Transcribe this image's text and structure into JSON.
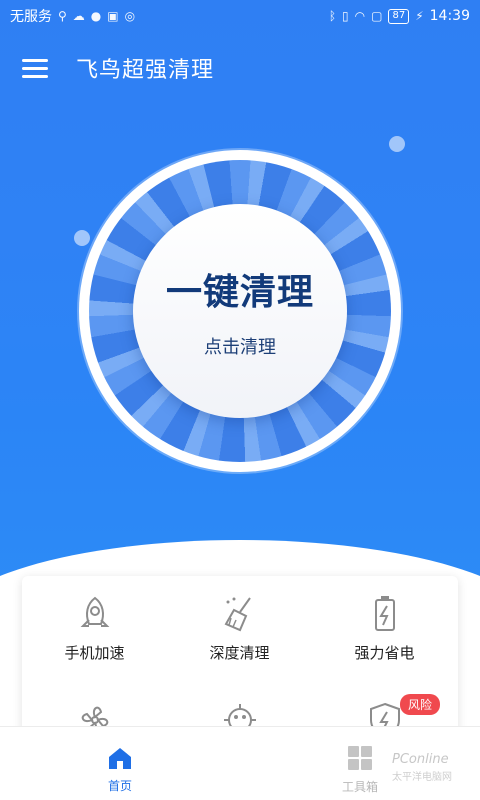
{
  "status_bar": {
    "carrier": "无服务",
    "battery": "87",
    "time": "14:39"
  },
  "header": {
    "title": "飞鸟超强清理",
    "menu_icon": "hamburger-menu-icon"
  },
  "cleaner": {
    "title": "一键清理",
    "subtitle": "点击清理"
  },
  "tools": [
    {
      "label": "手机加速",
      "icon": "rocket-icon"
    },
    {
      "label": "深度清理",
      "icon": "broom-icon"
    },
    {
      "label": "强力省电",
      "icon": "battery-icon"
    },
    {
      "label": "",
      "icon": "fan-icon"
    },
    {
      "label": "",
      "icon": "virus-icon"
    },
    {
      "label": "",
      "icon": "shield-icon",
      "badge": "风险"
    }
  ],
  "bottom_nav": {
    "home": "首页",
    "tools": "工具箱"
  },
  "watermark": {
    "brand": "PConline",
    "sub": "太平洋电脑网"
  },
  "colors": {
    "primary": "#2f82f5",
    "title_text": "#123a7a",
    "badge": "#f0494e"
  }
}
